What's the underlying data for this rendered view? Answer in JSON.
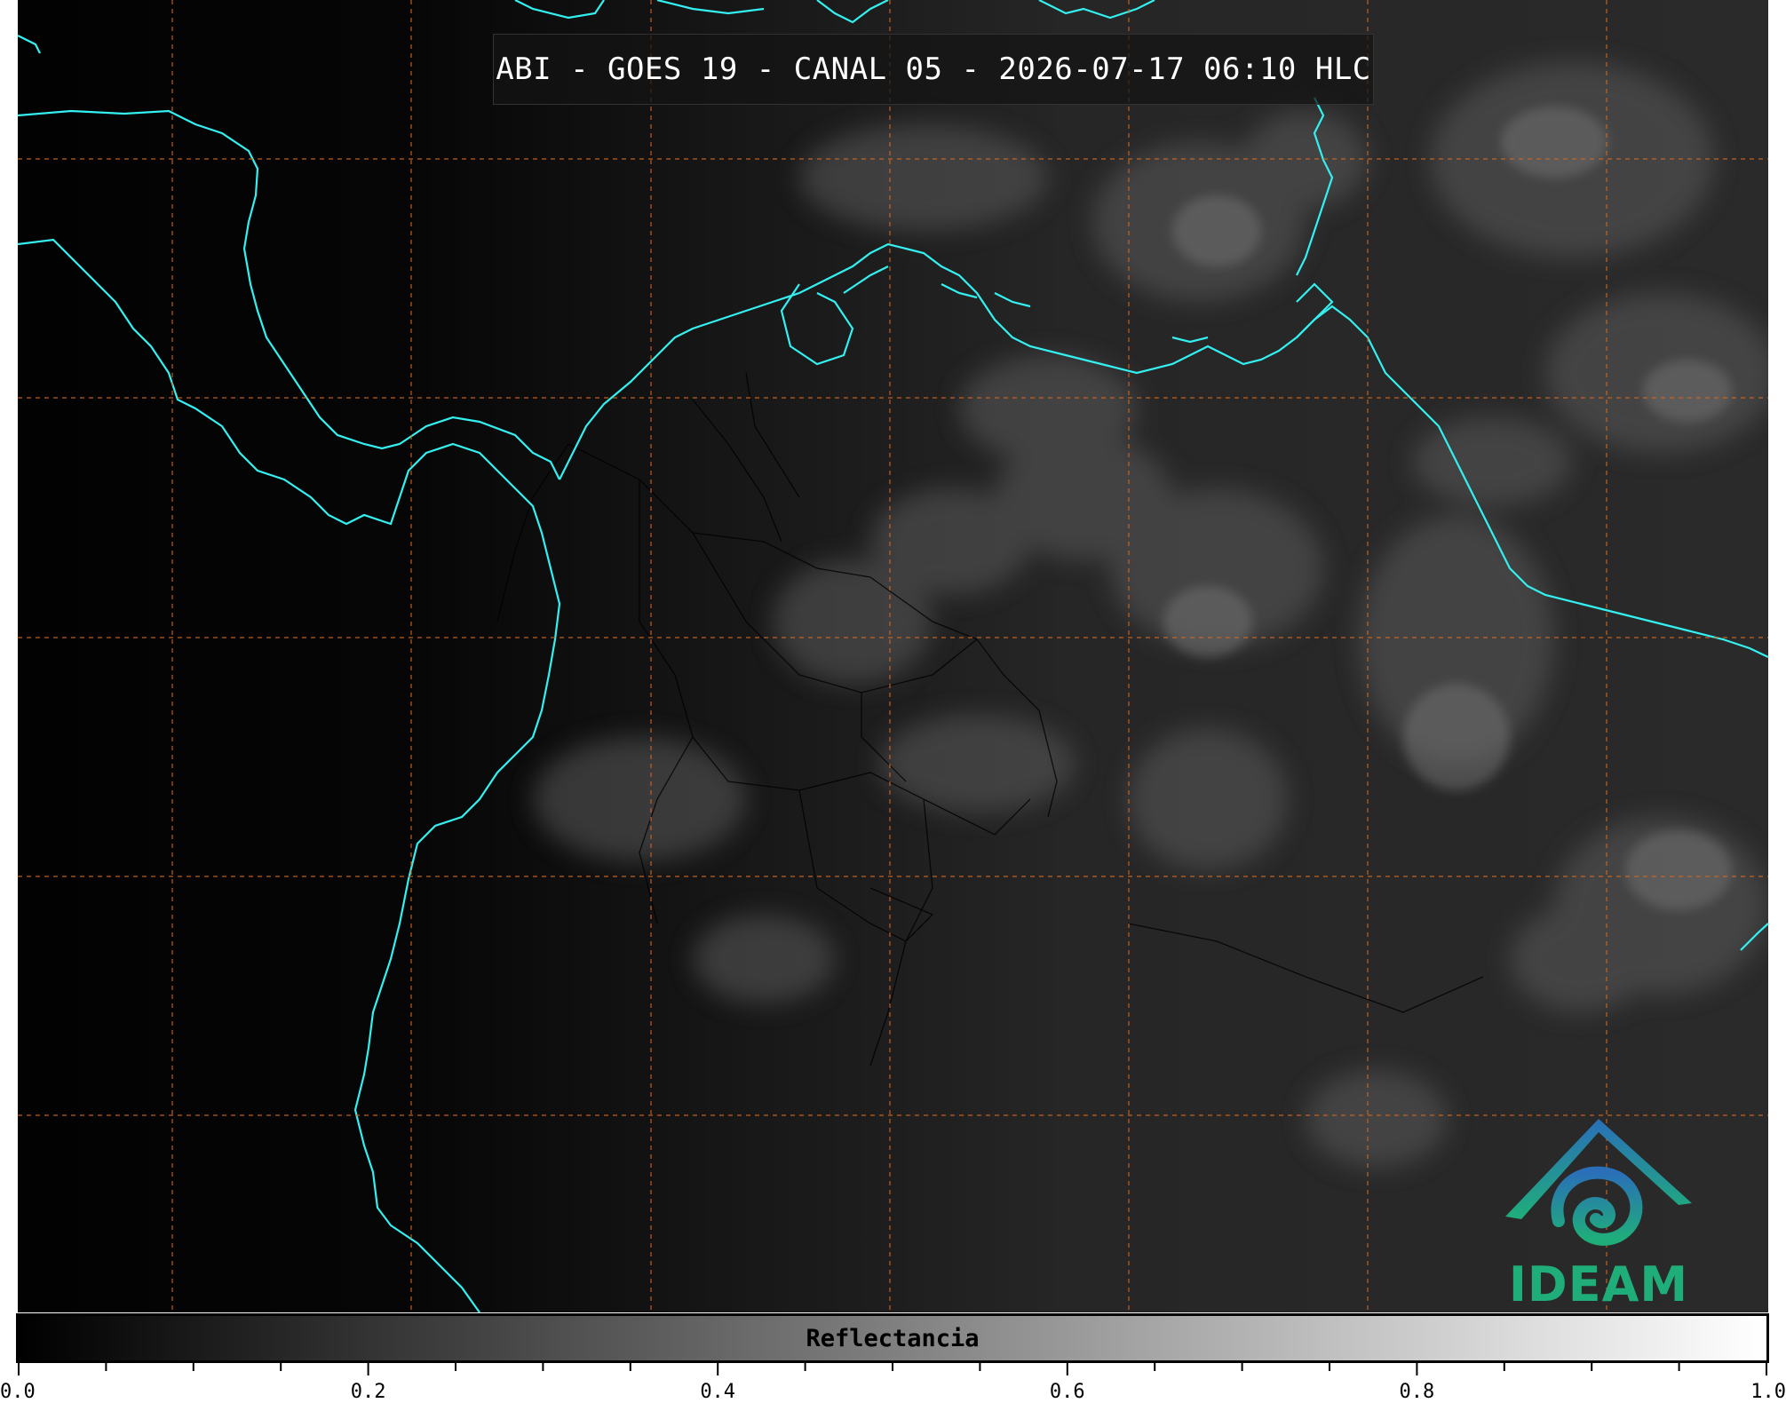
{
  "title": "ABI - GOES 19 - CANAL 05 - 2026-07-17 06:10 HLC",
  "colorbar": {
    "label": "Reflectancia",
    "range": [
      0.0,
      1.0
    ],
    "major_ticks": [
      "0.0",
      "0.2",
      "0.4",
      "0.6",
      "0.8",
      "1.0"
    ],
    "minor_tick_step": 0.05,
    "gradient_start": "#000000",
    "gradient_end": "#ffffff"
  },
  "logo": {
    "text": "IDEAM",
    "colors": [
      "#2a6fb8",
      "#1fae7a"
    ]
  },
  "map": {
    "coastline_color": "#34f0f0",
    "gridline_color": "#d2691e",
    "border_color": "#000000",
    "background_color": "#050505"
  }
}
